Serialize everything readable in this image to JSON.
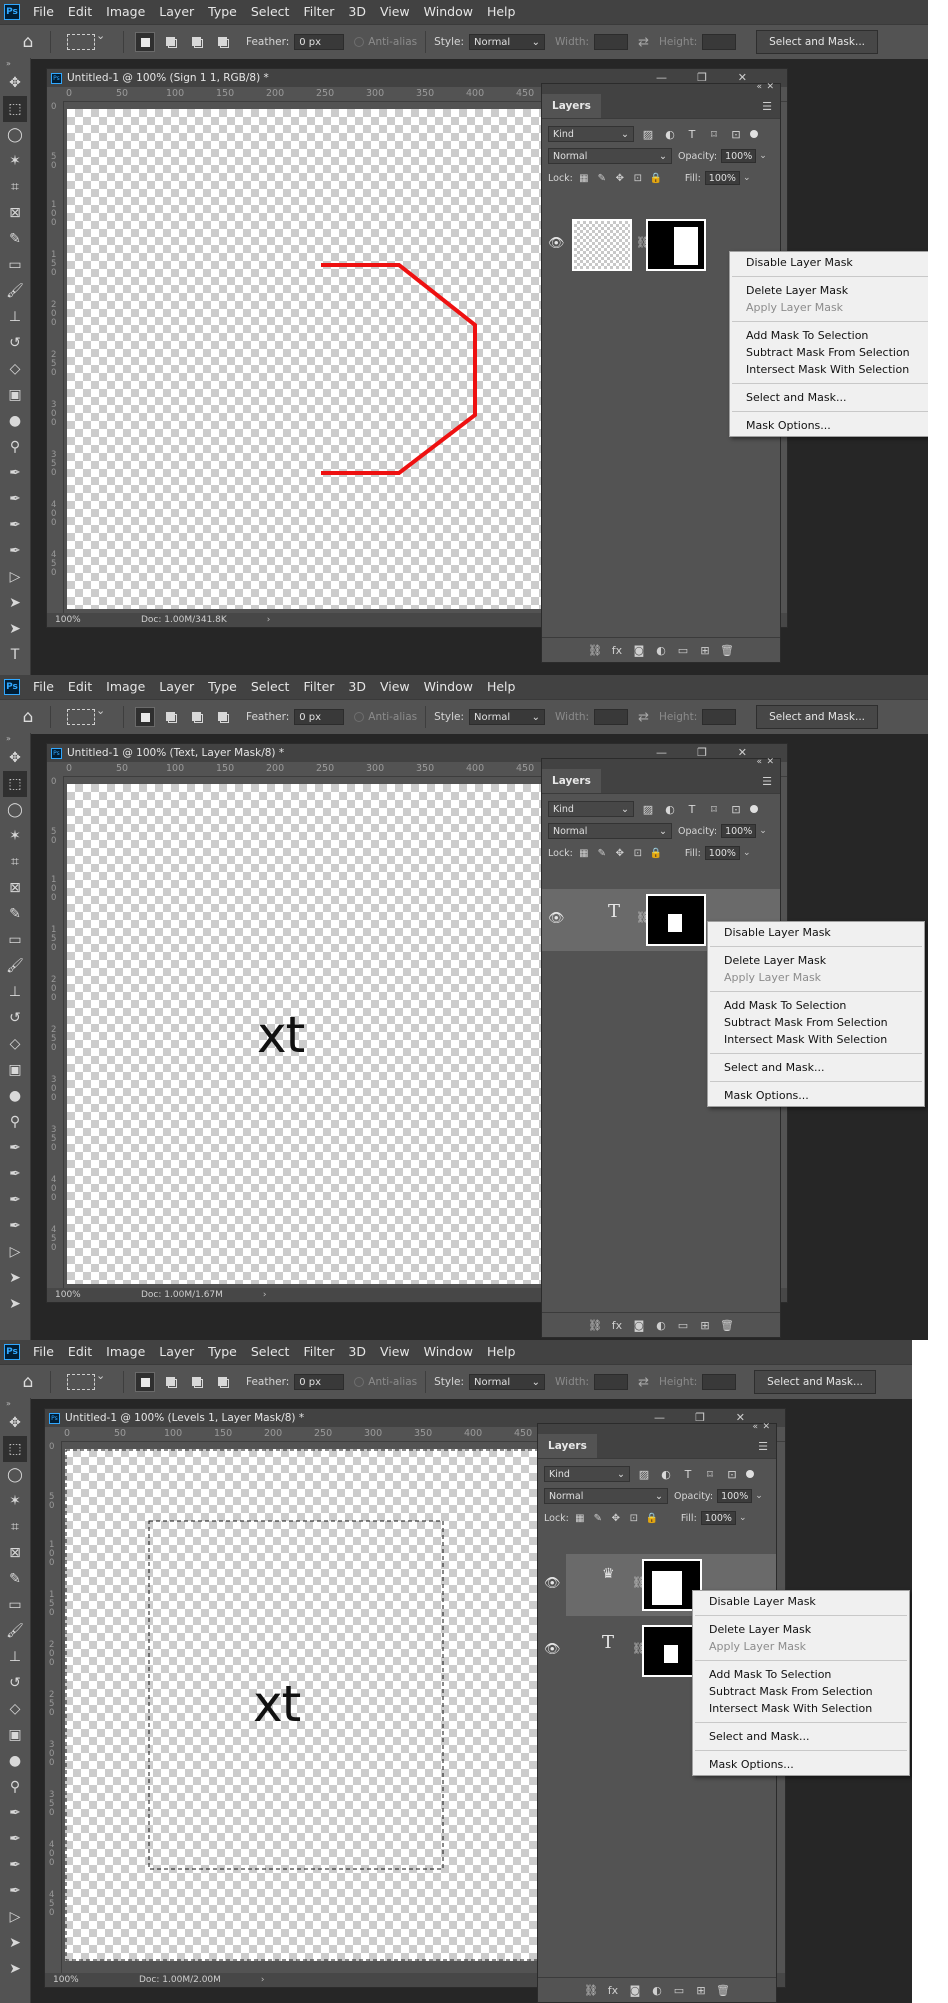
{
  "app": {
    "logo": "Ps",
    "menu": [
      "File",
      "Edit",
      "Image",
      "Layer",
      "Type",
      "Select",
      "Filter",
      "3D",
      "View",
      "Window",
      "Help"
    ]
  },
  "options": {
    "feather_label": "Feather:",
    "feather_value": "0 px",
    "antialias_label": "Anti-alias",
    "style_label": "Style:",
    "style_value": "Normal",
    "width_label": "Width:",
    "height_label": "Height:",
    "select_and_mask": "Select and Mask..."
  },
  "layers_panel": {
    "tab": "Layers",
    "kind": "Kind",
    "blend": "Normal",
    "opacity_label": "Opacity:",
    "opacity_value": "100%",
    "lock_label": "Lock:",
    "fill_label": "Fill:",
    "fill_value": "100%"
  },
  "context_menu": {
    "disable": "Disable Layer Mask",
    "delete": "Delete Layer Mask",
    "apply": "Apply Layer Mask",
    "add": "Add Mask To Selection",
    "subtract": "Subtract Mask From Selection",
    "intersect": "Intersect Mask With Selection",
    "select_mask": "Select and Mask...",
    "options": "Mask Options..."
  },
  "ruler": {
    "h": [
      "0",
      "50",
      "100",
      "150",
      "200",
      "250",
      "300",
      "350",
      "400",
      "450"
    ],
    "v": [
      "0",
      "50",
      "100",
      "150",
      "200",
      "250",
      "300",
      "350",
      "400",
      "450"
    ]
  },
  "screens": [
    {
      "doc_title": "Untitled-1 @ 100% (Sign 1 1, RGB/8) *",
      "zoom": "100%",
      "doc_size": "Doc: 1.00M/341.8K"
    },
    {
      "doc_title": "Untitled-1 @ 100% (Text, Layer Mask/8) *",
      "zoom": "100%",
      "doc_size": "Doc: 1.00M/1.67M",
      "canvas_text": "xt"
    },
    {
      "doc_title": "Untitled-1 @ 100% (Levels 1, Layer Mask/8) *",
      "zoom": "100%",
      "doc_size": "Doc: 1.00M/2.00M",
      "canvas_text": "xt"
    }
  ],
  "colors": {
    "shape_stroke": "#ee1111",
    "app_bg": "#262626",
    "panel_bg": "#535353"
  }
}
